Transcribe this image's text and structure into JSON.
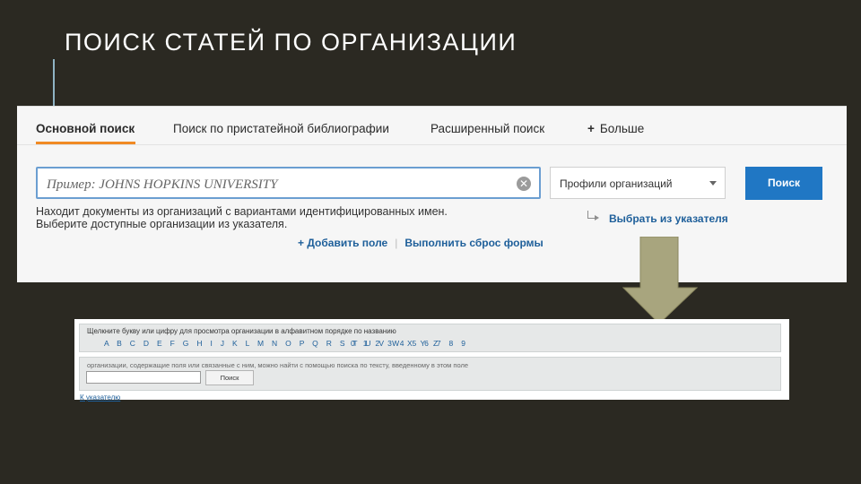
{
  "slide": {
    "title": "ПОИСК СТАТЕЙ ПО ОРГАНИЗАЦИИ"
  },
  "tabs": [
    {
      "label": "Основной поиск",
      "active": true
    },
    {
      "label": "Поиск по пристатейной библиографии"
    },
    {
      "label": "Расширенный поиск"
    },
    {
      "label": "Больше",
      "prefix": "+"
    }
  ],
  "search": {
    "placeholder": "Пример: JOHNS HOPKINS UNIVERSITY",
    "value": "",
    "field_select": "Профили организаций",
    "button_label": "Поиск",
    "help_line1": "Находит документы из организаций с вариантами идентифицированных имен.",
    "help_line2": "Выберите доступные организации из указателя.",
    "browse_link": "Выбрать из указателя",
    "add_field": "+ Добавить поле",
    "separator": "|",
    "reset_form": "Выполнить сброс формы"
  },
  "index_panel": {
    "alpha_caption": "Щелкните букву или цифру для просмотра организации в алфавитном порядке по названию",
    "letters": "A B C D E F G H I J K L M N O P Q R S T U V W X Y Z",
    "digits": "0 1 2 3 4 5 6 7 8 9",
    "search_caption": "организации, содержащие поля или связанные с ним, можно найти с помощью поиска по тексту, введенному в этом поле",
    "search_button": "Поиск",
    "back_link": "К указателю"
  },
  "colors": {
    "slide_bg": "#2b2922",
    "tab_accent": "#f08a24",
    "primary_button": "#2077c4",
    "link": "#1e5f9a",
    "arrow": "#a8a57e"
  }
}
